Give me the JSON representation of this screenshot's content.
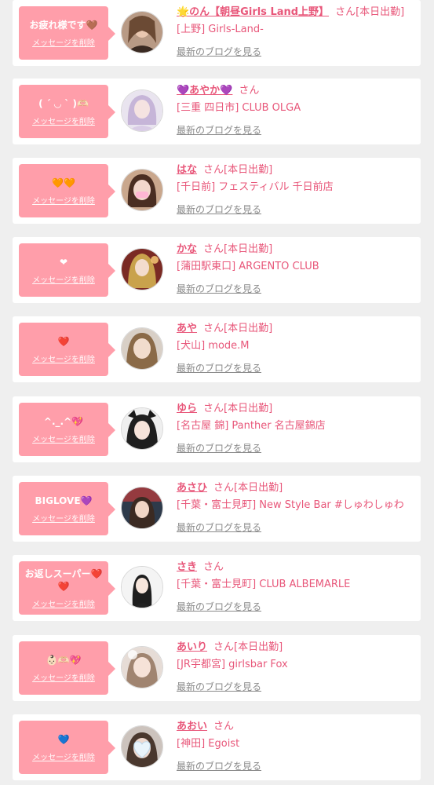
{
  "list": {
    "items": [
      {
        "message": "お疲れ様です🤎",
        "delete_label": "メッセージを削除",
        "name": "🌟のん【朝昼Girls Land上野】",
        "san": "さん",
        "status": "[本日出勤]",
        "shop": "[上野] Girls-Land-",
        "blog_link": "最新のブログを見る"
      },
      {
        "message": "( ´ ◡ ` )🫶🏻",
        "delete_label": "メッセージを削除",
        "name": "💜あやか💜",
        "san": "さん",
        "status": "",
        "shop": "[三重 四日市] CLUB OLGA",
        "blog_link": "最新のブログを見る"
      },
      {
        "message": "🧡🧡",
        "delete_label": "メッセージを削除",
        "name": "はな",
        "san": "さん",
        "status": "[本日出勤]",
        "shop": "[千日前] フェスティバル 千日前店",
        "blog_link": "最新のブログを見る"
      },
      {
        "message": "❤︎",
        "delete_label": "メッセージを削除",
        "name": "かな",
        "san": "さん",
        "status": "[本日出勤]",
        "shop": "[蒲田駅東口] ARGENTO CLUB",
        "blog_link": "最新のブログを見る"
      },
      {
        "message": "❤️",
        "delete_label": "メッセージを削除",
        "name": "あや",
        "san": "さん",
        "status": "[本日出勤]",
        "shop": "[犬山] mode.M",
        "blog_link": "最新のブログを見る"
      },
      {
        "message": "^._.^💖",
        "delete_label": "メッセージを削除",
        "name": "ゆら",
        "san": "さん",
        "status": "[本日出勤]",
        "shop": "[名古屋 錦] Panther 名古屋錦店",
        "blog_link": "最新のブログを見る"
      },
      {
        "message": "BIGLOVE💜",
        "delete_label": "メッセージを削除",
        "name": "あさひ",
        "san": "さん",
        "status": "[本日出勤]",
        "shop": "[千葉・富士見町] New Style Bar #しゅわしゅわ",
        "blog_link": "最新のブログを見る"
      },
      {
        "message": "お返しスーパー❤️❤️",
        "delete_label": "メッセージを削除",
        "name": "さき",
        "san": "さん",
        "status": "",
        "shop": "[千葉・富士見町] CLUB ALBEMARLE",
        "blog_link": "最新のブログを見る"
      },
      {
        "message": "👶🏻🫶🏻💖",
        "delete_label": "メッセージを削除",
        "name": "あいり",
        "san": "さん",
        "status": "[本日出勤]",
        "shop": "[JR宇都宮] girlsbar Fox",
        "blog_link": "最新のブログを見る"
      },
      {
        "message": "💙",
        "delete_label": "メッセージを削除",
        "name": "あおい",
        "san": "さん",
        "status": "",
        "shop": "[神田] Egoist",
        "blog_link": "最新のブログを見る"
      }
    ]
  },
  "colors": {
    "bubble": "#ff9eaa",
    "accent": "#e8577a",
    "link_gray": "#8a8a8a",
    "page_bg": "#efefef"
  },
  "icons": {
    "avatar": "user-photo"
  }
}
